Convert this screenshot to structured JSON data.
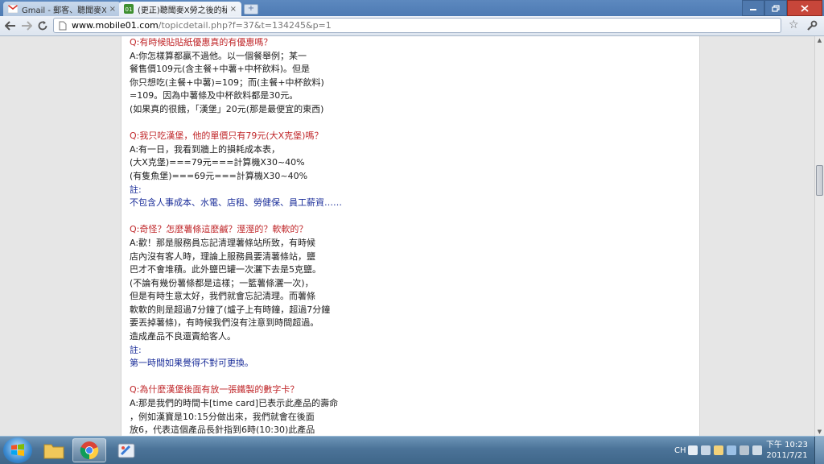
{
  "browser": {
    "tabs": [
      {
        "title": "Gmail - 郵客、聽聞麥X別",
        "active": false
      },
      {
        "title": "(更正)聽聞麥X勞之後的秘密",
        "active": true
      }
    ],
    "new_tab_label": "+",
    "url_host": "www.mobile01.com",
    "url_path": "/topicdetail.php?f=37&t=134245&p=1"
  },
  "post": {
    "lines": [
      {
        "cls": "q",
        "text": "Q:有時候貼貼紙優惠真的有優惠嗎？"
      },
      {
        "cls": "",
        "text": "A:你怎樣算都贏不過他。以一個餐舉例；某一"
      },
      {
        "cls": "",
        "text": "餐售價109元(含主餐+中薯+中杯飲料)。但是"
      },
      {
        "cls": "",
        "text": "你只想吃(主餐+中薯)=109；而(主餐+中杯飲料)"
      },
      {
        "cls": "",
        "text": "=109。因為中薯條及中杯飲料都是30元。"
      },
      {
        "cls": "",
        "text": "(如果真的很餓，「漢堡」20元(那是最便宜的東西)"
      },
      {
        "cls": "gap",
        "text": ""
      },
      {
        "cls": "q",
        "text": "Q:我只吃漢堡，他的單價只有79元(大X克堡)嗎？"
      },
      {
        "cls": "",
        "text": "A:有一日，我看到牆上的損耗成本表，"
      },
      {
        "cls": "",
        "text": "(大X克堡)===79元===計算機X30~40%"
      },
      {
        "cls": "",
        "text": "(有隻魚堡)===69元===計算機X30~40%"
      },
      {
        "cls": "n",
        "text": "註:"
      },
      {
        "cls": "n",
        "text": "不包含人事成本、水電、店租、勞健保、員工薪資……"
      },
      {
        "cls": "gap",
        "text": ""
      },
      {
        "cls": "q",
        "text": "Q:奇怪？怎麼薯條這麼鹹？溼溼的？軟軟的？"
      },
      {
        "cls": "",
        "text": "A:歡！那是服務員忘記清理薯條站所致，有時候"
      },
      {
        "cls": "",
        "text": "店內沒有客人時，理論上服務員要清薯條站，鹽"
      },
      {
        "cls": "",
        "text": "巴才不會堆積。此外鹽巴罐一次灑下去是5克鹽。"
      },
      {
        "cls": "",
        "text": "(不論有幾份薯條都是這樣；一籃薯條灑一次)，"
      },
      {
        "cls": "",
        "text": "但是有時生意太好，我們就會忘記清理。而薯條"
      },
      {
        "cls": "",
        "text": "軟軟的則是超過7分鐘了(爐子上有時鐘，超過7分鐘"
      },
      {
        "cls": "",
        "text": "要丟掉薯條)，有時候我們沒有注意到時間超過。"
      },
      {
        "cls": "",
        "text": "造成產品不良還賣給客人。"
      },
      {
        "cls": "n",
        "text": "註:"
      },
      {
        "cls": "n",
        "text": "第一時間如果覺得不對可更換。"
      },
      {
        "cls": "gap",
        "text": ""
      },
      {
        "cls": "q",
        "text": "Q:為什麼漢堡後面有放一張鐵製的數字卡？"
      },
      {
        "cls": "",
        "text": "A:那是我們的時間卡[time card]已表示此產品的壽命"
      },
      {
        "cls": "",
        "text": "，例如漢寶是10:15分做出來，我們就會在後面"
      },
      {
        "cls": "",
        "text": "放6，代表這個產品長針指到6時(10:30)此產品"
      }
    ]
  },
  "taskbar": {
    "lang": "CH",
    "clock_time": "下午 10:23",
    "clock_date": "2011/7/21"
  },
  "colors": {
    "question": "#c0282b",
    "note": "#1c2f9a"
  }
}
